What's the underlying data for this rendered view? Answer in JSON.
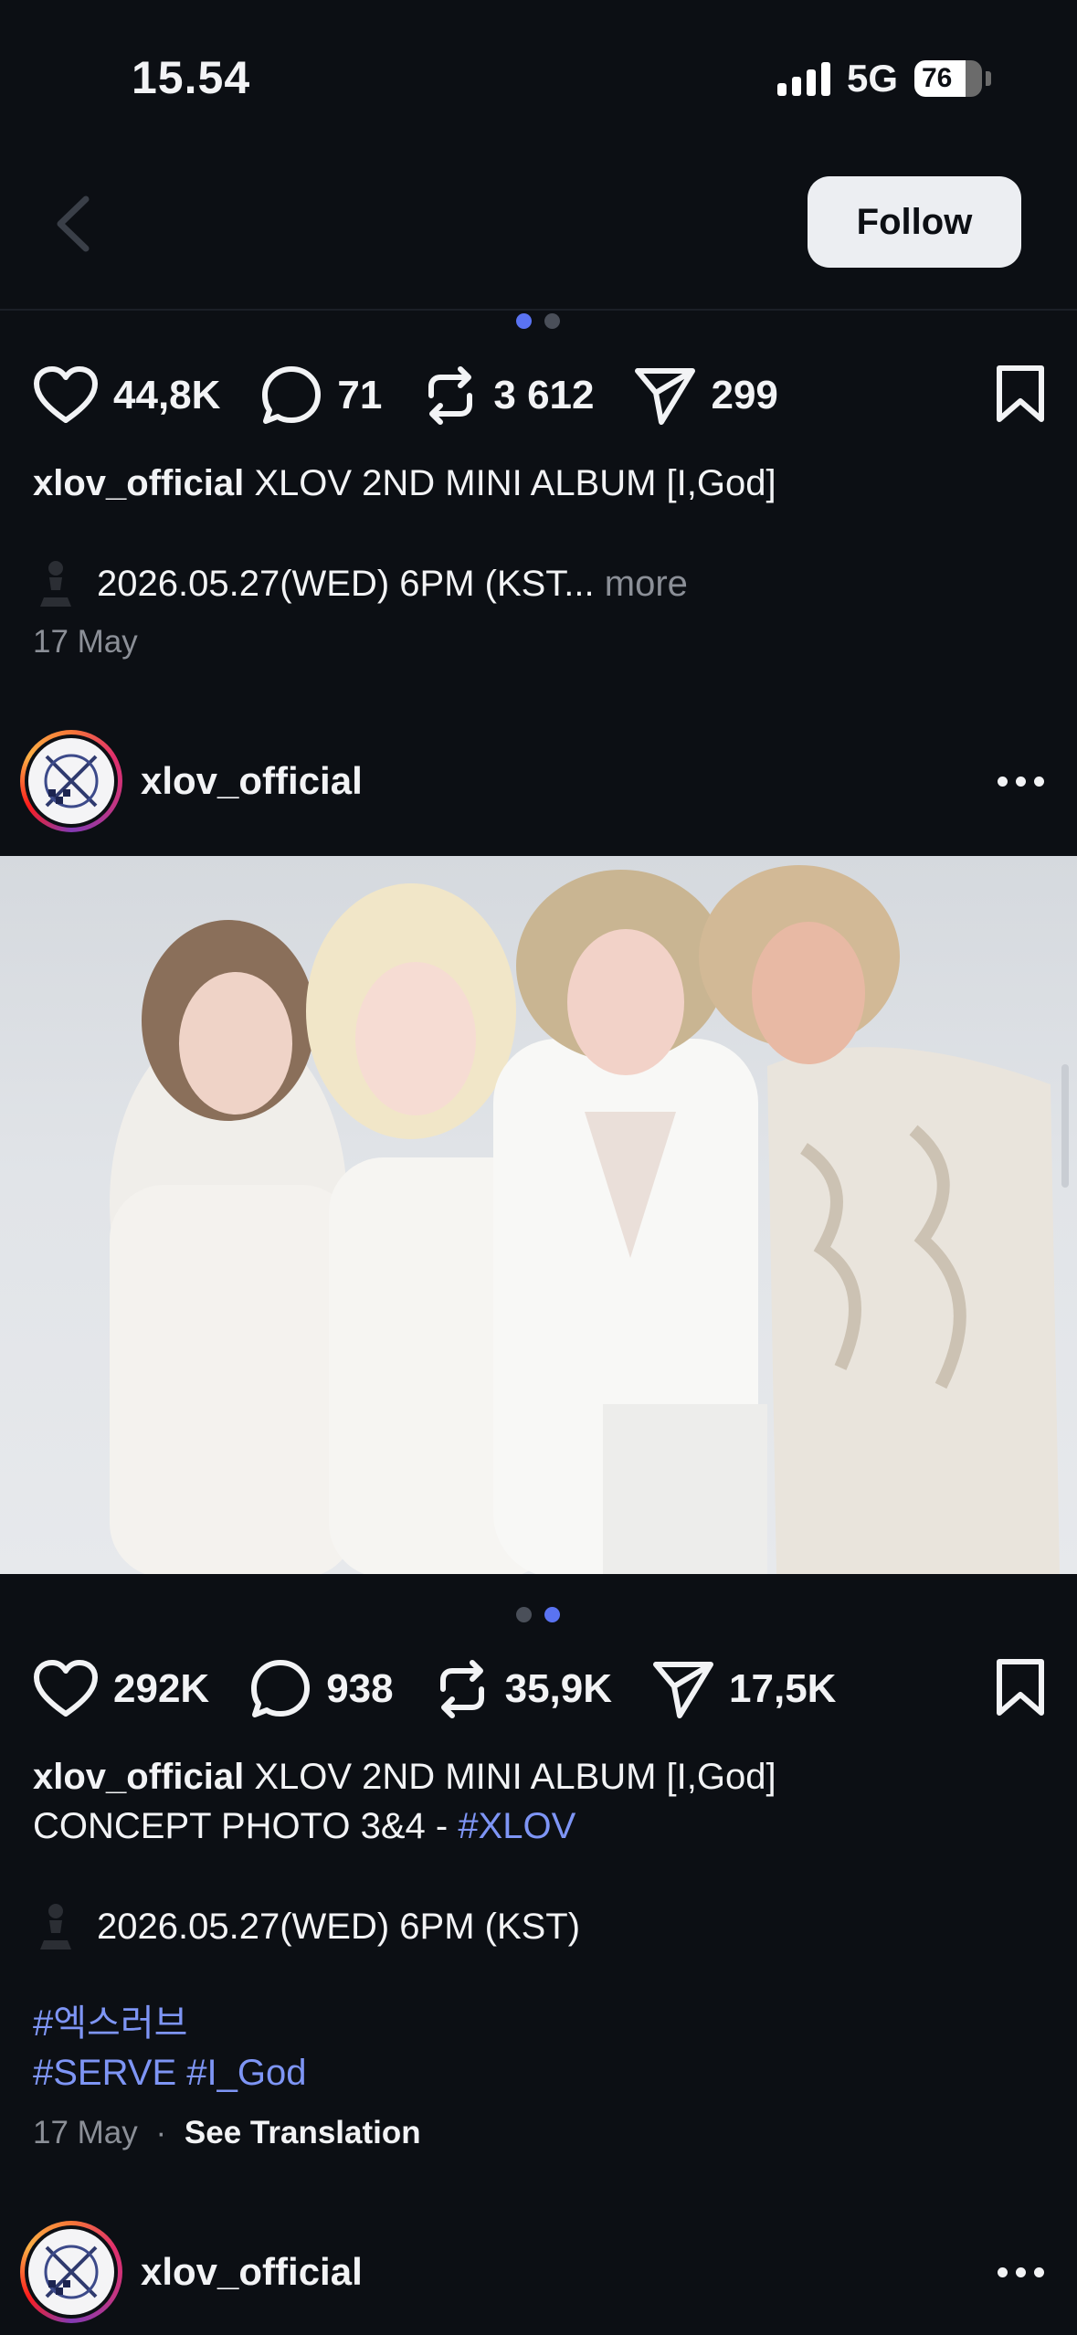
{
  "status_bar": {
    "time": "15.54",
    "network": "5G",
    "battery": "76"
  },
  "header": {
    "follow_label": "Follow"
  },
  "post1": {
    "likes": "44,8K",
    "comments": "71",
    "reposts": "3 612",
    "shares": "299",
    "username": "xlov_official",
    "caption": "XLOV 2ND MINI ALBUM [I,God]",
    "detail_line": "2026.05.27(WED) 6PM (KST...",
    "more_label": "more",
    "date": "17 May"
  },
  "post2": {
    "username": "xlov_official",
    "likes": "292K",
    "comments": "938",
    "reposts": "35,9K",
    "shares": "17,5K",
    "caption_line1": "XLOV 2ND MINI ALBUM [I,God]",
    "caption_line2": "CONCEPT PHOTO 3&4 -",
    "caption_tag": "#XLOV",
    "detail_line": "2026.05.27(WED) 6PM (KST)",
    "hashtag_line1": "#엑스러브",
    "hashtag_line2a": "#SERVE",
    "hashtag_line2b": "#I_God",
    "date": "17 May",
    "separator": "·",
    "translation_label": "See Translation"
  },
  "post3": {
    "username": "xlov_official"
  },
  "icons": [
    "chevron-left-icon",
    "heart-icon",
    "comment-icon",
    "repost-icon",
    "share-icon",
    "bookmark-icon",
    "chess-pawn-icon",
    "more-icon"
  ],
  "colors": {
    "background": "#0c0f14",
    "accent_dot": "#5a73f2",
    "hashtag": "#7e95f5",
    "follow_button": "#eceef2"
  }
}
